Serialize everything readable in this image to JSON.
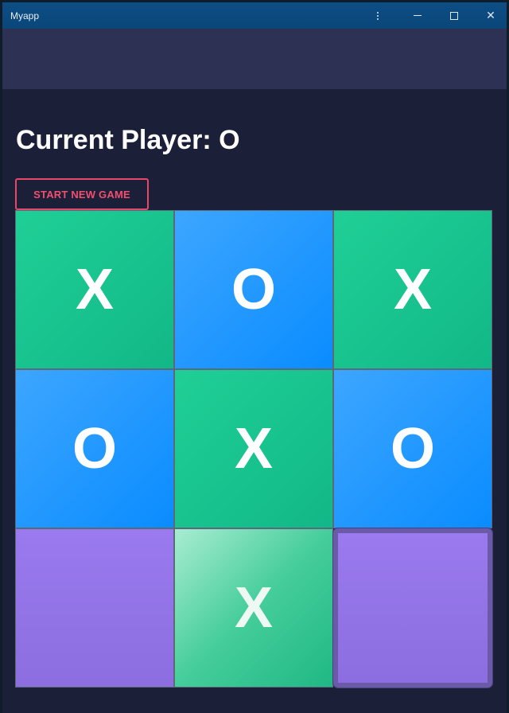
{
  "window": {
    "title": "Myapp"
  },
  "game": {
    "heading": "Current Player: O",
    "new_game_label": "START NEW GAME",
    "board": [
      [
        "X",
        "O",
        "X"
      ],
      [
        "O",
        "X",
        "O"
      ],
      [
        "",
        "X",
        ""
      ]
    ]
  },
  "colors": {
    "accent": "#e8476a",
    "cell_x": "#1fcf96",
    "cell_o": "#0a8cff",
    "cell_empty": "#9a7aee",
    "background": "#1b1f38",
    "titlebar": "#0d4e86"
  }
}
